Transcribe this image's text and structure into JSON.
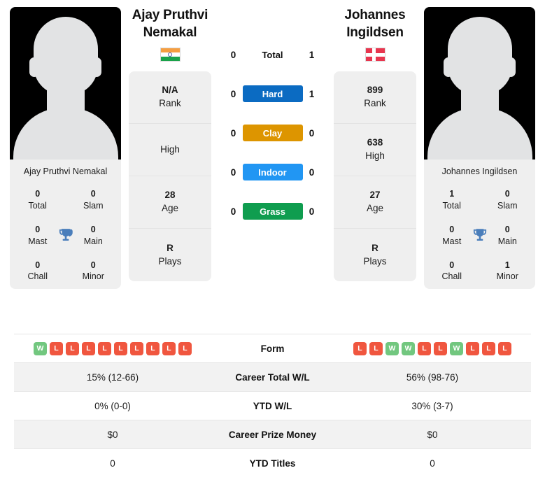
{
  "colors": {
    "hard": "#0b6bc2",
    "clay": "#dd9500",
    "indoor": "#2196f3",
    "grass": "#0f9d4f",
    "win_badge": "#72c77f",
    "loss_badge": "#f0563f",
    "trophy": "#4a7ebb",
    "card_bg": "#efefef",
    "row_alt_bg": "#f2f2f2"
  },
  "players": {
    "left": {
      "name_line1": "Ajay Pruthvi",
      "name_line2": "Nemakal",
      "photo_caption": "Ajay Pruthvi Nemakal",
      "flag": "india-flag-icon",
      "titles": {
        "total_value": "0",
        "total_label": "Total",
        "slam_value": "0",
        "slam_label": "Slam",
        "mast_value": "0",
        "mast_label": "Mast",
        "main_value": "0",
        "main_label": "Main",
        "chall_value": "0",
        "chall_label": "Chall",
        "minor_value": "0",
        "minor_label": "Minor"
      },
      "info": [
        {
          "value": "N/A",
          "label": "Rank"
        },
        {
          "value": "",
          "label": "High"
        },
        {
          "value": "28",
          "label": "Age"
        },
        {
          "value": "R",
          "label": "Plays"
        }
      ],
      "form": [
        "W",
        "L",
        "L",
        "L",
        "L",
        "L",
        "L",
        "L",
        "L",
        "L"
      ],
      "career_total_wl": "15% (12-66)",
      "ytd_wl": "0% (0-0)",
      "career_prize_money": "$0",
      "ytd_titles": "0"
    },
    "right": {
      "name_line1": "Johannes",
      "name_line2": "Ingildsen",
      "photo_caption": "Johannes Ingildsen",
      "flag": "denmark-flag-icon",
      "titles": {
        "total_value": "1",
        "total_label": "Total",
        "slam_value": "0",
        "slam_label": "Slam",
        "mast_value": "0",
        "mast_label": "Mast",
        "main_value": "0",
        "main_label": "Main",
        "chall_value": "0",
        "chall_label": "Chall",
        "minor_value": "1",
        "minor_label": "Minor"
      },
      "info": [
        {
          "value": "899",
          "label": "Rank"
        },
        {
          "value": "638",
          "label": "High"
        },
        {
          "value": "27",
          "label": "Age"
        },
        {
          "value": "R",
          "label": "Plays"
        }
      ],
      "form": [
        "L",
        "L",
        "W",
        "W",
        "L",
        "L",
        "W",
        "L",
        "L",
        "L"
      ],
      "career_total_wl": "56% (98-76)",
      "ytd_wl": "30% (3-7)",
      "career_prize_money": "$0",
      "ytd_titles": "0"
    }
  },
  "head_to_head": {
    "rows": [
      {
        "label": "Total",
        "left": "0",
        "right": "1",
        "style": "plain"
      },
      {
        "label": "Hard",
        "left": "0",
        "right": "1",
        "style": "hard"
      },
      {
        "label": "Clay",
        "left": "0",
        "right": "0",
        "style": "clay"
      },
      {
        "label": "Indoor",
        "left": "0",
        "right": "0",
        "style": "indoor"
      },
      {
        "label": "Grass",
        "left": "0",
        "right": "0",
        "style": "grass"
      }
    ]
  },
  "table": {
    "rows": [
      {
        "label": "Form",
        "key": "form"
      },
      {
        "label": "Career Total W/L",
        "key": "career_total_wl"
      },
      {
        "label": "YTD W/L",
        "key": "ytd_wl"
      },
      {
        "label": "Career Prize Money",
        "key": "career_prize_money"
      },
      {
        "label": "YTD Titles",
        "key": "ytd_titles"
      }
    ]
  }
}
